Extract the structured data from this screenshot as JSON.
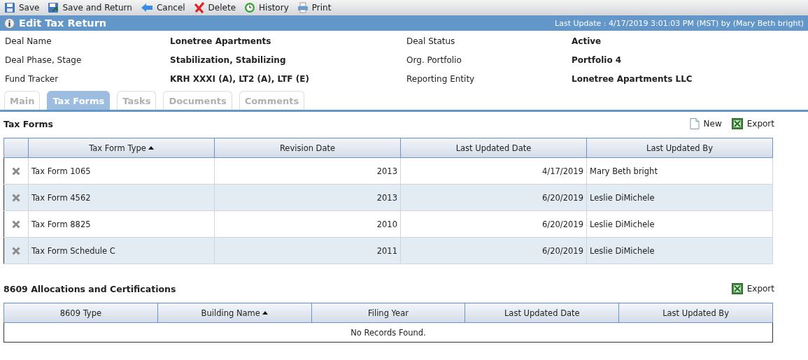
{
  "toolbar": [
    {
      "kind": "save",
      "label": "Save"
    },
    {
      "kind": "save_return",
      "label": "Save and Return"
    },
    {
      "kind": "cancel",
      "label": "Cancel"
    },
    {
      "kind": "delete",
      "label": "Delete"
    },
    {
      "kind": "history",
      "label": "History"
    },
    {
      "kind": "print",
      "label": "Print"
    }
  ],
  "header": {
    "title": "Edit Tax Return",
    "last_update": "Last Update : 4/17/2019 3:01:03 PM (MST) by (Mary Beth bright)"
  },
  "fields": [
    {
      "label": "Deal Name",
      "value": "Lonetree Apartments"
    },
    {
      "label": "Deal Status",
      "value": "Active"
    },
    {
      "label": "Deal Phase, Stage",
      "value": "Stabilization, Stabilizing"
    },
    {
      "label": "Org. Portfolio",
      "value": "Portfolio 4"
    },
    {
      "label": "Fund Tracker",
      "value": "KRH XXXI (A), LT2 (A), LTF (E)"
    },
    {
      "label": "Reporting Entity",
      "value": "Lonetree Apartments LLC"
    }
  ],
  "tabs": [
    {
      "label": "Main",
      "selected": false
    },
    {
      "label": "Tax Forms",
      "selected": true
    },
    {
      "label": "Tasks",
      "selected": false
    },
    {
      "label": "Documents",
      "selected": false
    },
    {
      "label": "Comments",
      "selected": false
    }
  ],
  "tax_forms": {
    "title": "Tax Forms",
    "actions": [
      {
        "kind": "new",
        "label": "New"
      },
      {
        "kind": "export",
        "label": "Export"
      }
    ],
    "columns": [
      {
        "label": "Tax Form Type",
        "sorted": true
      },
      {
        "label": "Revision Date",
        "sorted": false
      },
      {
        "label": "Last Updated Date",
        "sorted": false
      },
      {
        "label": "Last Updated By",
        "sorted": false
      }
    ],
    "rows": [
      [
        "Tax Form 1065",
        "2013",
        "4/17/2019",
        "Mary Beth bright"
      ],
      [
        "Tax Form 4562",
        "2013",
        "6/20/2019",
        "Leslie DiMichele"
      ],
      [
        "Tax Form 8825",
        "2010",
        "6/20/2019",
        "Leslie DiMichele"
      ],
      [
        "Tax Form Schedule C",
        "2011",
        "6/20/2019",
        "Leslie DiMichele"
      ]
    ]
  },
  "allocations": {
    "title": "8609 Allocations and Certifications",
    "actions": [
      {
        "kind": "export",
        "label": "Export"
      }
    ],
    "columns": [
      {
        "label": "8609 Type",
        "sorted": false
      },
      {
        "label": "Building Name",
        "sorted": true
      },
      {
        "label": "Filing Year",
        "sorted": false
      },
      {
        "label": "Last Updated Date",
        "sorted": false
      },
      {
        "label": "Last Updated By",
        "sorted": false
      }
    ],
    "empty_message": "No Records Found."
  }
}
